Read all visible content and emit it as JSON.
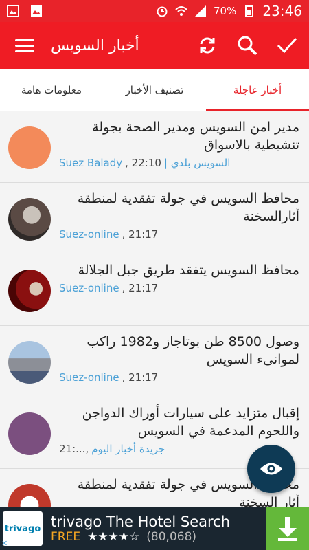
{
  "status": {
    "battery": "70%",
    "time": "23:46"
  },
  "appbar": {
    "title": "أخبار السويس"
  },
  "tabs": [
    "معلومات هامة",
    "تصنيف الأخبار",
    "أخبار عاجلة"
  ],
  "items": [
    {
      "headline": "مدير امن السويس ومدير الصحة بجولة تنشيطية بالاسواق",
      "source": "Suez Balady",
      "time": ", 22:10",
      "source_ar": "السويس بلدي |",
      "avatar_color": "#f38a5a"
    },
    {
      "headline": "محافظ السويس في جولة تفقدية لمنطقة أثارالسخنة",
      "source": "Suez-online",
      "time": ", 21:17",
      "avatar_color": "#6b5e57"
    },
    {
      "headline": "محافظ السويس يتفقد طريق جبل الجلالة",
      "source": "Suez-online",
      "time": ", 21:17",
      "avatar_color": "#b11d1d"
    },
    {
      "headline": "وصول 8500 طن بوتاجاز و1982 راكب لموانىء السويس",
      "source": "Suez-online",
      "time": ", 21:17",
      "avatar_color": "#7f8fa6"
    },
    {
      "headline": "إقبال متزايد على سيارات أوراك الدواجن واللحوم المدعمة في السويس",
      "source": "جريدة أخبار اليوم",
      "time": "21:...,",
      "avatar_color": "#7b4f7f"
    },
    {
      "headline": "محافظ السويس في جولة تفقدية لمنطقة أثار السخنة",
      "source": "",
      "time": "",
      "avatar_color": "#c0392b"
    }
  ],
  "ad": {
    "brand": "trivago",
    "title": "trivago The Hotel Search",
    "free": "FREE",
    "stars": "★★★★☆",
    "count": "(80,068)"
  }
}
